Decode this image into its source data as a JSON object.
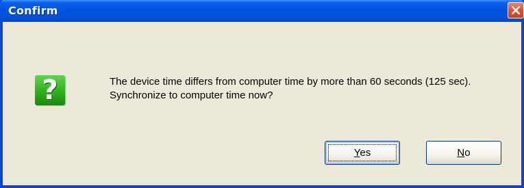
{
  "window": {
    "title": "Confirm"
  },
  "icons": {
    "close": "close-icon",
    "question": "question-icon"
  },
  "dialog": {
    "icon_glyph": "?",
    "message_line_1": "The device time differs from computer time by more than 60 seconds (125 sec).",
    "message_line_2": "Synchronize to computer time now?"
  },
  "buttons": {
    "yes_mnemonic": "Y",
    "yes_rest": "es",
    "no_mnemonic": "N",
    "no_rest": "o"
  },
  "colors": {
    "title_bar": "#0053e0",
    "dialog_background": "#ece9d8",
    "close_button": "#e2542f",
    "question_icon": "#2fb11e"
  }
}
